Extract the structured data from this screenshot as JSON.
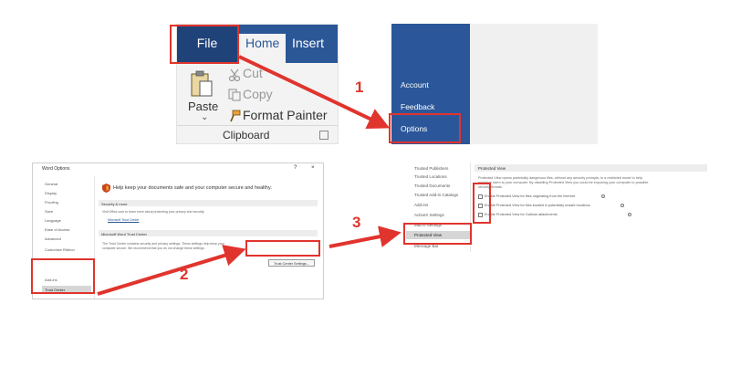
{
  "ribbon": {
    "tabs": [
      "File",
      "Home",
      "Insert"
    ],
    "commands": [
      "Cut",
      "Copy",
      "Format Painter"
    ],
    "paste_label": "Paste",
    "group_label": "Clipboard"
  },
  "backstage": {
    "items": [
      "Account",
      "Feedback",
      "Options"
    ]
  },
  "word_options": {
    "title": "Word Options",
    "window_buttons": [
      "?",
      "×"
    ],
    "sidebar": [
      "General",
      "Display",
      "Proofing",
      "Save",
      "Language",
      "Ease of Access",
      "Advanced",
      "Customize Ribbon",
      "Add-ins",
      "Trust Center"
    ],
    "header": "Help keep your documents safe and your computer secure and healthy.",
    "sections": [
      "Security & more",
      "Microsoft Word Trust Center"
    ],
    "security_text": "Visit Office.com to learn more about protecting your privacy and security.",
    "security_link": "Microsoft Trust Center",
    "trust_text_1": "The Trust Center contains security and privacy settings. These settings help keep your",
    "trust_text_2": "computer secure. We recommend that you do not change these settings.",
    "trust_button": "Trust Center Settings..."
  },
  "trust_center": {
    "sidebar": [
      "Trusted Publishers",
      "Trusted Locations",
      "Trusted Documents",
      "Trusted Add-in Catalogs",
      "Add-ins",
      "ActiveX Settings",
      "Macro Settings",
      "Protected View",
      "Message Bar"
    ],
    "section": "Protected View",
    "desc_lines": [
      "Protected View opens potentially dangerous files, without any security prompts, in a restricted mode to help",
      "minimize harm to your computer. By disabling Protected View you could be exposing your computer to possible",
      "security threats."
    ],
    "options": [
      "Enable Protected View for files originating from the Internet",
      "Enable Protected View for files located in potentially unsafe locations",
      "Enable Protected View for Outlook attachments"
    ]
  },
  "steps": [
    "1",
    "2",
    "3"
  ],
  "colors": {
    "accent_red": "#e0342d",
    "word_blue": "#2b579a",
    "ribbon_bg": "#f3f3f3"
  }
}
